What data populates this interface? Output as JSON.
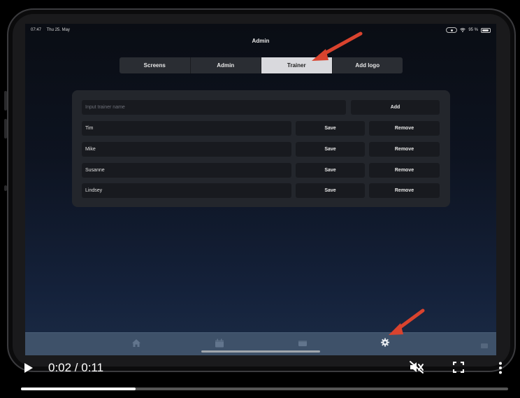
{
  "status_bar": {
    "time": "07:47",
    "date": "Thu 25. May",
    "battery": "95 %",
    "battery_level": 0.95
  },
  "page_title": "Admin",
  "tabs": [
    {
      "label": "Screens",
      "active": false
    },
    {
      "label": "Admin",
      "active": false
    },
    {
      "label": "Trainer",
      "active": true
    },
    {
      "label": "Add logo",
      "active": false
    }
  ],
  "trainer_form": {
    "input_placeholder": "Input trainer name",
    "add_label": "Add",
    "save_label": "Save",
    "remove_label": "Remove",
    "trainers": [
      "Tim",
      "Mike",
      "Susanne",
      "Lindsey"
    ]
  },
  "tab_bar": {
    "icons": [
      "home-icon",
      "calendar-icon",
      "tray-icon",
      "gear-icon"
    ],
    "active": "gear-icon"
  },
  "video_player": {
    "time": "0:02 / 0:11",
    "progress": 0.235,
    "muted": true
  },
  "colors": {
    "annotation_arrow": "#d9432e",
    "active_tab": "#d9d9dd",
    "tab_bar": "#3e5169"
  }
}
